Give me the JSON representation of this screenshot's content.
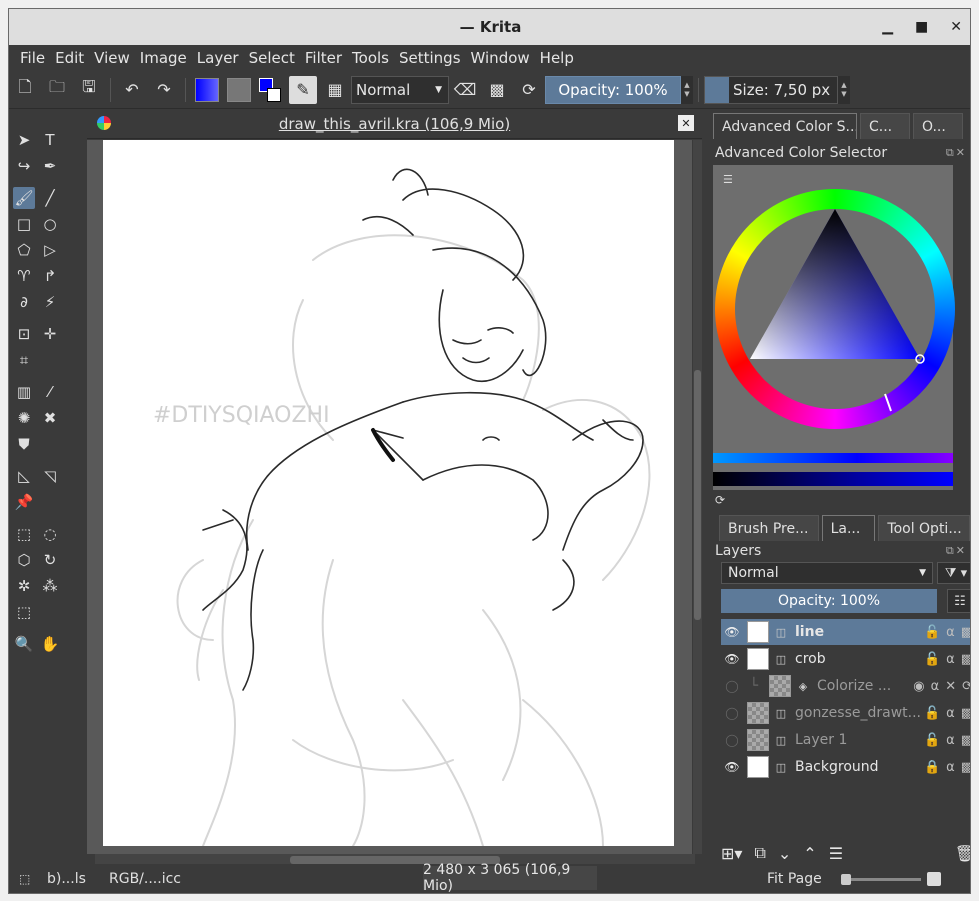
{
  "window": {
    "title": "— Krita"
  },
  "menu": [
    "File",
    "Edit",
    "View",
    "Image",
    "Layer",
    "Select",
    "Filter",
    "Tools",
    "Settings",
    "Window",
    "Help"
  ],
  "toolbar": {
    "blend_mode": "Normal",
    "opacity": "Opacity: 100%",
    "size": "Size: 7,50 px"
  },
  "document": {
    "tab_title": "draw_this_avril.kra (106,9 Mio)",
    "watermark": "#DTIYSQIAOZHI"
  },
  "docker": {
    "tabs": [
      "Advanced Color S...",
      "C...",
      "O..."
    ],
    "title": "Advanced Color Selector"
  },
  "layers_docker": {
    "tabs": [
      "Brush Pre...",
      "La...",
      "Tool Opti..."
    ],
    "title": "Layers",
    "blend_mode": "Normal",
    "opacity": "Opacity:  100%",
    "layers": [
      {
        "name": "line",
        "visible": true,
        "selected": true
      },
      {
        "name": "crob",
        "visible": true,
        "selected": false
      },
      {
        "name": "Colorize ...",
        "visible": false,
        "selected": false
      },
      {
        "name": "gonzesse_drawt...",
        "visible": false,
        "selected": false
      },
      {
        "name": "Layer 1",
        "visible": false,
        "selected": false
      },
      {
        "name": "Background",
        "visible": true,
        "selected": false
      }
    ]
  },
  "status": {
    "brush": "b)...ls",
    "color_profile": "RGB/....icc",
    "dimensions": "2 480 x 3 065 (106,9 Mio)",
    "zoom": "Fit Page"
  },
  "colors": {
    "accent": "#5d7a99",
    "foreground": "#0000ff",
    "background": "#ffffff"
  }
}
